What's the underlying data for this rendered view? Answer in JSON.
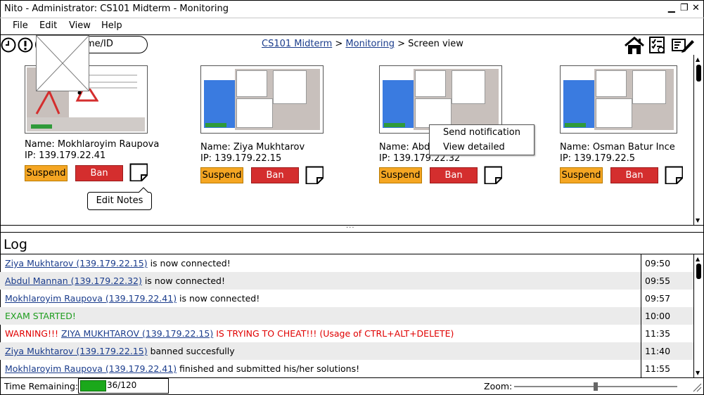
{
  "window": {
    "title": "Nito - Administrator: CS101 Midterm - Monitoring",
    "controls": [
      "▁",
      "❐",
      "✕"
    ]
  },
  "menu": [
    "File",
    "Edit",
    "View",
    "Help"
  ],
  "toolbar": {
    "search_placeholder": "me/ID",
    "icons": [
      "clock-icon",
      "alert-icon",
      "home-icon",
      "checklist-icon",
      "edit-icon"
    ]
  },
  "breadcrumb": {
    "course": "CS101 Midterm",
    "sep1": ">",
    "page": "Monitoring",
    "sep2": ">",
    "current": "Screen view"
  },
  "students": [
    {
      "name": "Name: Mokhlaroyim Raupova",
      "ip": "IP: 139.179.22.41",
      "suspend": "Suspend",
      "ban": "Ban"
    },
    {
      "name": "Name: Ziya Mukhtarov",
      "ip": "IP: 139.179.22.15",
      "suspend": "Suspend",
      "ban": "Ban"
    },
    {
      "name": "Name: Abdul",
      "ip": "IP: 139.179.22.32",
      "suspend": "Suspend",
      "ban": "Ban"
    },
    {
      "name": "Name: Osman Batur Ince",
      "ip": "IP: 139.179.22.5",
      "suspend": "Suspend",
      "ban": "Ban"
    }
  ],
  "tooltip": "Edit Notes",
  "context_menu": [
    "Send notification",
    "View detailed"
  ],
  "divider_handle": "...",
  "log": {
    "title": "Log",
    "rows": [
      {
        "link": "Ziya Mukhtarov (139.179.22.15)",
        "text": " is now connected!",
        "time": "09:50"
      },
      {
        "link": "Abdul Mannan (139.179.22.32)",
        "text": " is now connected!",
        "time": "09:55"
      },
      {
        "link": "Mokhlaroyim Raupova (139.179.22.41)",
        "text": " is now connected!",
        "time": "09:57"
      },
      {
        "link": "",
        "text": "EXAM STARTED!",
        "time": "10:00",
        "color": "#1e9d1e"
      },
      {
        "prefix": "WARNING!!! ",
        "link": "ZIYA MUKHTAROV (139.179.22.15)",
        "text": " IS TRYING TO CHEAT!!! (Usage of CTRL+ALT+DELETE)",
        "time": "11:35",
        "color": "#e00000"
      },
      {
        "link": "Ziya Mukhtarov (139.179.22.15)",
        "text": " banned succesfully",
        "time": "11:40"
      },
      {
        "link": "Mokhlaroyim Raupova (139.179.22.41)",
        "text": " finished and submitted his/her solutions!",
        "time": "11:55"
      }
    ]
  },
  "status": {
    "time_label": "Time Remaining:",
    "time_value": "36/120",
    "time_fraction": 0.3,
    "zoom_label": "Zoom:",
    "zoom_fraction": 0.5
  },
  "colors": {
    "suspend": "#f5a623",
    "ban": "#d42e2e",
    "link": "#1a3c8c",
    "warning": "#e00000",
    "success": "#1e9d1e",
    "progress": "#1ba81b"
  }
}
